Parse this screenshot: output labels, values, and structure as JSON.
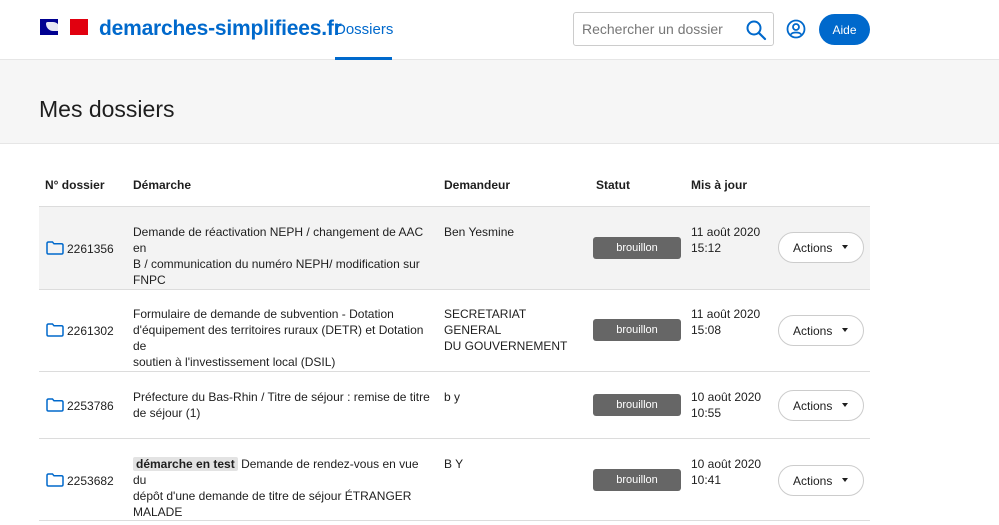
{
  "header": {
    "site_name": "demarches-simplifiees.fr",
    "nav": {
      "dossiers_label": "Dossiers"
    },
    "search": {
      "placeholder": "Rechercher un dossier",
      "value": ""
    },
    "help_label": "Aide",
    "colors": {
      "brand_blue": "#0069cc",
      "flag_blue": "#000091",
      "flag_red": "#e1000f"
    }
  },
  "page": {
    "title": "Mes dossiers"
  },
  "table": {
    "columns": [
      "N° dossier",
      "Démarche",
      "Demandeur",
      "Statut",
      "Mis à jour"
    ],
    "rows": [
      {
        "number": "2261356",
        "demarche_tag": "",
        "demarche": [
          "Demande de réactivation NEPH / changement de AAC en",
          "B / communication du numéro NEPH/ modification sur",
          "FNPC"
        ],
        "demandeur": [
          "Ben Yesmine"
        ],
        "statut": "brouillon",
        "date": "11 août 2020",
        "time": "15:12",
        "actions_label": "Actions"
      },
      {
        "number": "2261302",
        "demarche_tag": "",
        "demarche": [
          "Formulaire de demande de subvention - Dotation",
          "d'équipement des territoires ruraux (DETR) et Dotation de",
          "soutien à l'investissement local (DSIL)"
        ],
        "demandeur": [
          "SECRETARIAT GENERAL",
          "DU GOUVERNEMENT"
        ],
        "statut": "brouillon",
        "date": "11 août 2020",
        "time": "15:08",
        "actions_label": "Actions"
      },
      {
        "number": "2253786",
        "demarche_tag": "",
        "demarche": [
          "Préfecture du Bas-Rhin / Titre de séjour : remise de titre",
          "de séjour (1)"
        ],
        "demandeur": [
          "b y"
        ],
        "statut": "brouillon",
        "date": "10 août 2020",
        "time": "10:55",
        "actions_label": "Actions"
      },
      {
        "number": "2253682",
        "demarche_tag": "démarche en test",
        "demarche": [
          "Demande de rendez-vous en vue du",
          "dépôt d'une demande de titre de séjour ÉTRANGER",
          "MALADE"
        ],
        "demandeur": [
          "B Y"
        ],
        "statut": "brouillon",
        "date": "10 août 2020",
        "time": "10:41",
        "actions_label": "Actions"
      }
    ]
  }
}
